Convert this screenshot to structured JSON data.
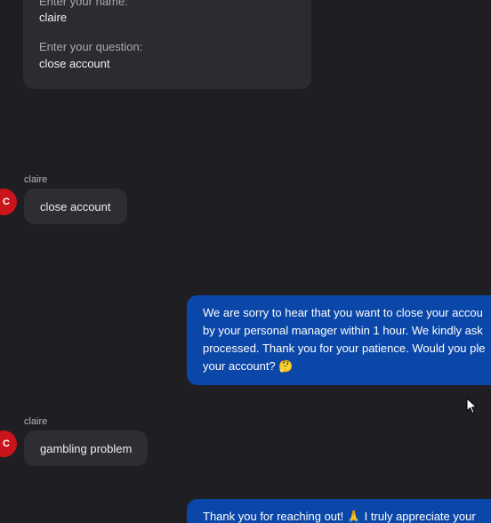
{
  "form": {
    "name_label": "Enter your name:",
    "name_value": "claire",
    "question_label": "Enter your question:",
    "question_value": "close account"
  },
  "messages": [
    {
      "sender": "claire",
      "avatar_letter": "C",
      "text": "close account"
    },
    {
      "sender": "agent",
      "lines": [
        "We are sorry to hear that you want to close your accou",
        "by your personal manager within 1 hour. We kindly ask",
        "processed. Thank you for your patience. Would you ple",
        "your account? 🤔"
      ]
    },
    {
      "sender": "claire",
      "avatar_letter": "C",
      "text": "gambling problem"
    },
    {
      "sender": "agent",
      "lines": [
        "Thank you for reaching out! 🙏 I truly appreciate your"
      ]
    }
  ],
  "colors": {
    "background": "#1f1f23",
    "form_card": "#2b2b30",
    "user_bubble": "#2d2d32",
    "agent_bubble": "#0b47a8",
    "avatar": "#c8141a"
  },
  "icons": {
    "cursor": "mouse-pointer-icon"
  }
}
